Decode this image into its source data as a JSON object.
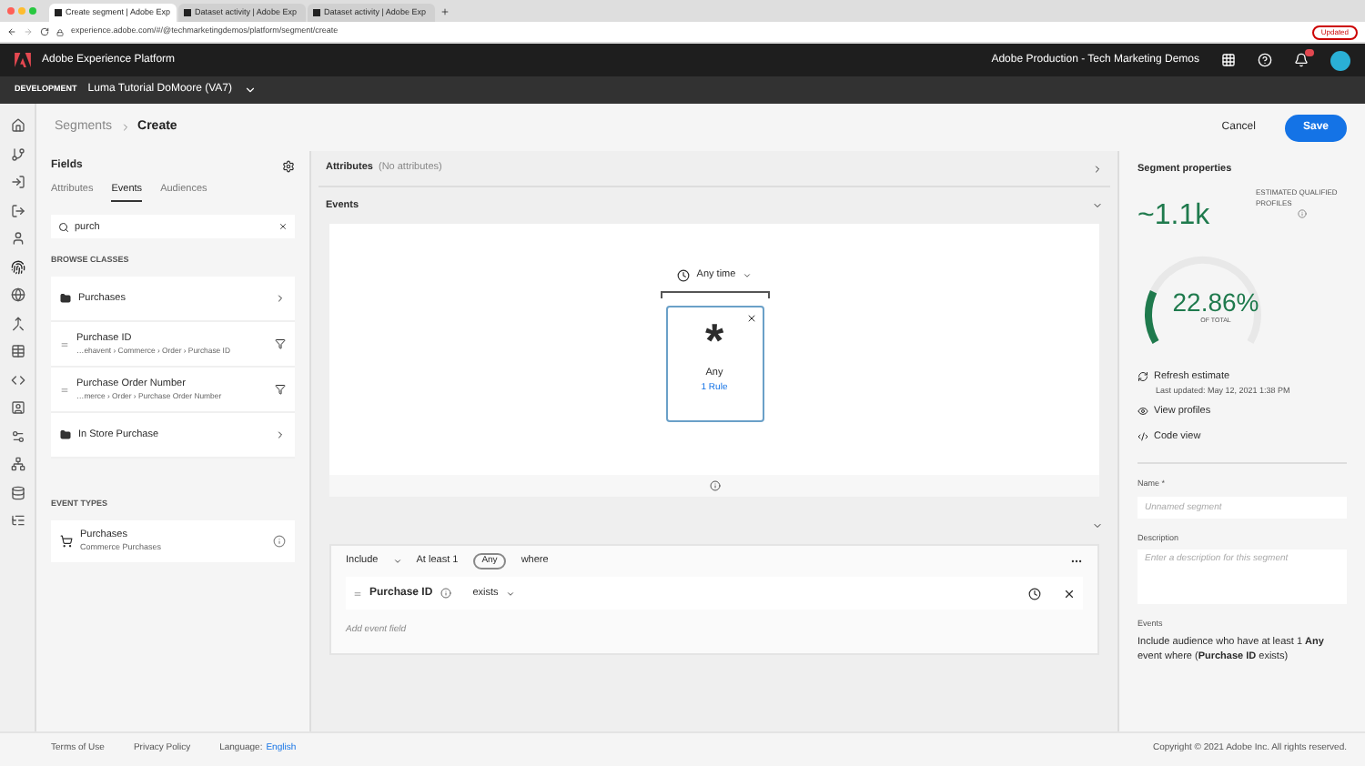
{
  "browser": {
    "tabs": [
      {
        "title": "Create segment | Adobe Exp",
        "selected": true
      },
      {
        "title": "Dataset activity | Adobe Exp",
        "selected": false
      },
      {
        "title": "Dataset activity | Adobe Exp",
        "selected": false
      }
    ],
    "url": "experience.adobe.com/#/@techmarketingdemos/platform/segment/create",
    "update_button": "Updated"
  },
  "app_bar": {
    "product": "Adobe Experience Platform",
    "org": "Adobe Production - Tech Marketing Demos"
  },
  "env_bar": {
    "environment": "DEVELOPMENT",
    "sandbox": "Luma Tutorial DoMoore (VA7)"
  },
  "breadcrumb": [
    {
      "label": "Segments",
      "selected": false
    },
    {
      "label": "Create",
      "selected": true
    }
  ],
  "actions": {
    "cancel": "Cancel",
    "save": "Save"
  },
  "fields_panel": {
    "title": "Fields",
    "tabs": [
      {
        "label": "Attributes",
        "selected": false
      },
      {
        "label": "Events",
        "selected": true
      },
      {
        "label": "Audiences",
        "selected": false
      }
    ],
    "search": {
      "value": "purch"
    },
    "browse_heading": "BROWSE CLASSES",
    "classes": [
      {
        "kind": "folder",
        "label": "Purchases"
      },
      {
        "kind": "field",
        "label": "Purchase ID",
        "path": "…ehavent › Commerce › Order › Purchase ID"
      },
      {
        "kind": "field",
        "label": "Purchase Order Number",
        "path": "…merce › Order › Purchase Order Number"
      },
      {
        "kind": "folder",
        "label": "In Store Purchase"
      }
    ],
    "event_types_heading": "EVENT TYPES",
    "event_types": [
      {
        "label": "Purchases",
        "sublabel": "Commerce Purchases"
      }
    ]
  },
  "attributes_section": {
    "title": "Attributes",
    "note": "(No attributes)"
  },
  "events_section": {
    "title": "Events",
    "time_filter": "Any time",
    "card": {
      "symbol": "*",
      "title": "Any",
      "rules": "1 Rule"
    }
  },
  "rule": {
    "include": "Include",
    "at_least": "At least 1",
    "any": "Any",
    "where": "where",
    "field": "Purchase ID",
    "operator": "exists",
    "add_placeholder": "Add event field"
  },
  "properties": {
    "title": "Segment properties",
    "estimate": "~1.1k",
    "estimate_label": "ESTIMATED QUALIFIED PROFILES",
    "percent": "22.86%",
    "percent_label": "OF TOTAL",
    "level": 0.2286,
    "refresh": "Refresh estimate",
    "last_updated": "Last updated: May 12, 2021 1:38 PM",
    "view_profiles": "View profiles",
    "code_view": "Code view",
    "name_label": "Name *",
    "name_placeholder": "Unnamed segment",
    "description_label": "Description",
    "description_placeholder": "Enter a description for this segment",
    "events_label": "Events",
    "summary": "Include audience who have at least 1 **Any** event where (**Purchase ID** exists)"
  },
  "footer": {
    "links": [
      "Terms of Use",
      "Privacy Policy"
    ],
    "language_label": "Language:",
    "language": "English",
    "copyright": "Copyright © 2021 Adobe Inc. All rights reserved."
  }
}
